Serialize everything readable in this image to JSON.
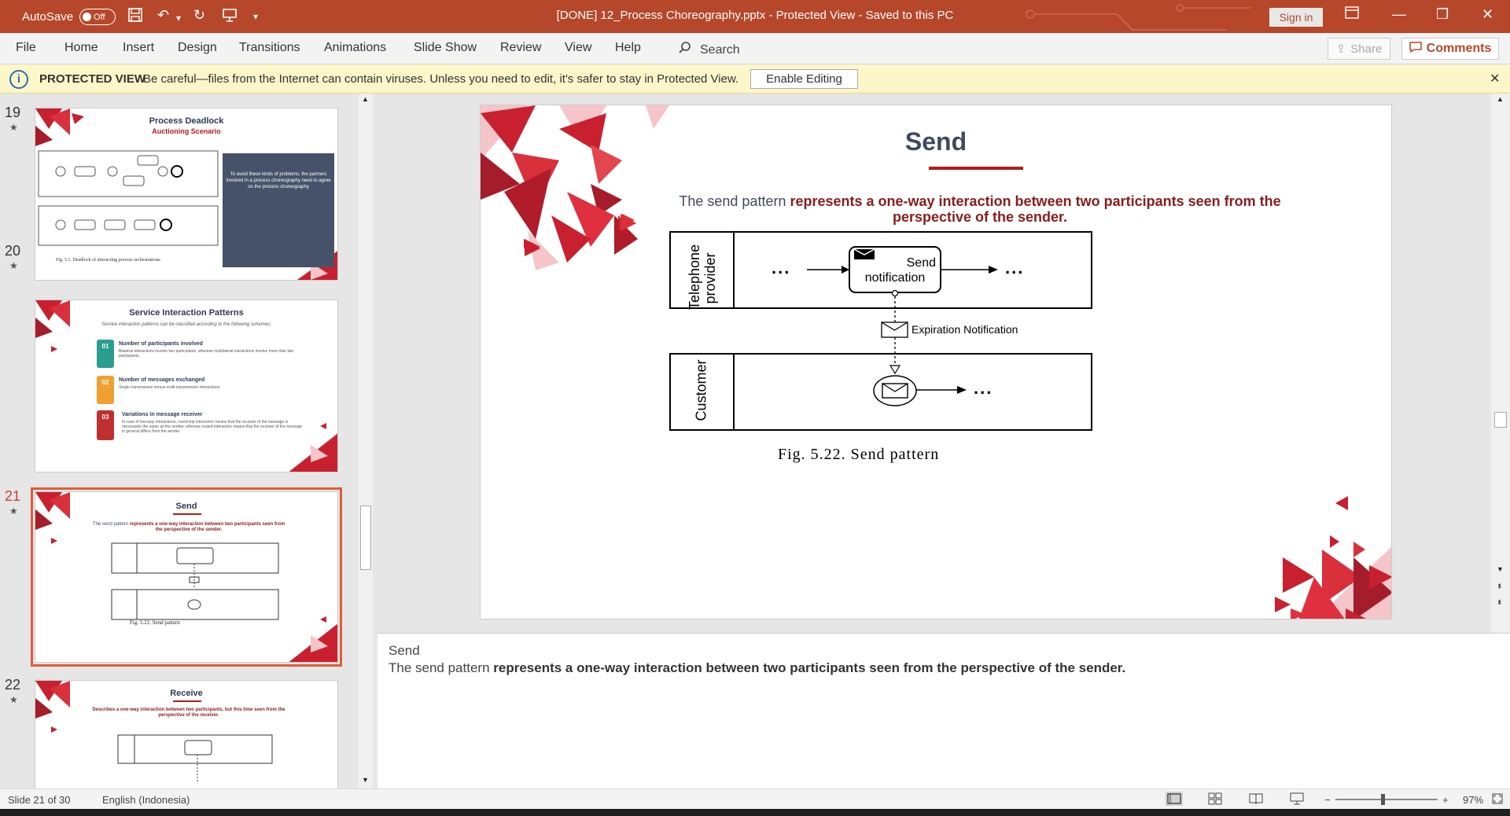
{
  "titlebar": {
    "autosave_label": "AutoSave",
    "autosave_state": "Off",
    "document_title": "[DONE] 12_Process Choreography.pptx  -  Protected View  -  Saved to this PC",
    "signin": "Sign in",
    "accent_color": "#b7472a"
  },
  "ribbon": {
    "tabs": [
      "File",
      "Home",
      "Insert",
      "Design",
      "Transitions",
      "Animations",
      "Slide Show",
      "Review",
      "View",
      "Help"
    ],
    "search": "Search",
    "share": "Share",
    "comments": "Comments"
  },
  "protected_view": {
    "label": "PROTECTED VIEW",
    "message": "Be careful—files from the Internet can contain viruses. Unless you need to edit, it's safer to stay in Protected View.",
    "enable_button": "Enable Editing"
  },
  "thumbnails": [
    {
      "number": "19",
      "title": "Process Deadlock",
      "subtitle": "Auctioning Scenario",
      "caption": "Fig. 5.1. Deadlock of interacting process orchestrations",
      "side_text": "To avoid these kinds of problems, the partners involved in a process choreography need to agree on the process choreography"
    },
    {
      "number": "20",
      "title": "Service Interaction Patterns",
      "subtitle": "Service interaction patterns can be classified according to the following schemes:",
      "items": [
        {
          "num": "01",
          "head": "Number of participants involved",
          "text": "Bilateral interactions involve two participants, whereas multilateral interactions involve more than two participants."
        },
        {
          "num": "02",
          "head": "Number of messages exchanged",
          "text": "Single transmission versus multi-transmission interactions."
        },
        {
          "num": "03",
          "head": "Variations in message receiver",
          "text": "In case of two-way interactions, round-trip interaction means that the receiver of the message is necessarily the same as the sender, whereas routed interaction means that the receiver of the message in general differs from the sender."
        }
      ]
    },
    {
      "number": "21",
      "title": "Send",
      "selected": true
    },
    {
      "number": "22",
      "title": "Receive",
      "subtitle": "Describes a one-way interaction between two participants, but this time seen from the perspective of the receiver."
    }
  ],
  "slide": {
    "title": "Send",
    "subtitle_plain": "The send pattern ",
    "subtitle_bold": "represents a one-way interaction between two participants seen from the perspective of the sender.",
    "diagram": {
      "pool_top": "Telephone provider",
      "pool_top_line1": "Telephone",
      "pool_top_line2": "provider",
      "pool_bottom": "Customer",
      "task_line1": "Send",
      "task_line2": "notification",
      "message": "Expiration Notification",
      "ellipsis": "...",
      "caption": "Fig. 5.22. Send pattern"
    }
  },
  "notes": {
    "line1": "Send",
    "line2_plain": "The send pattern ",
    "line2_bold": "represents a one-way interaction between two participants seen from the perspective of the sender."
  },
  "status": {
    "slide_counter": "Slide 21 of 30",
    "language": "English (Indonesia)",
    "zoom": "97%"
  }
}
